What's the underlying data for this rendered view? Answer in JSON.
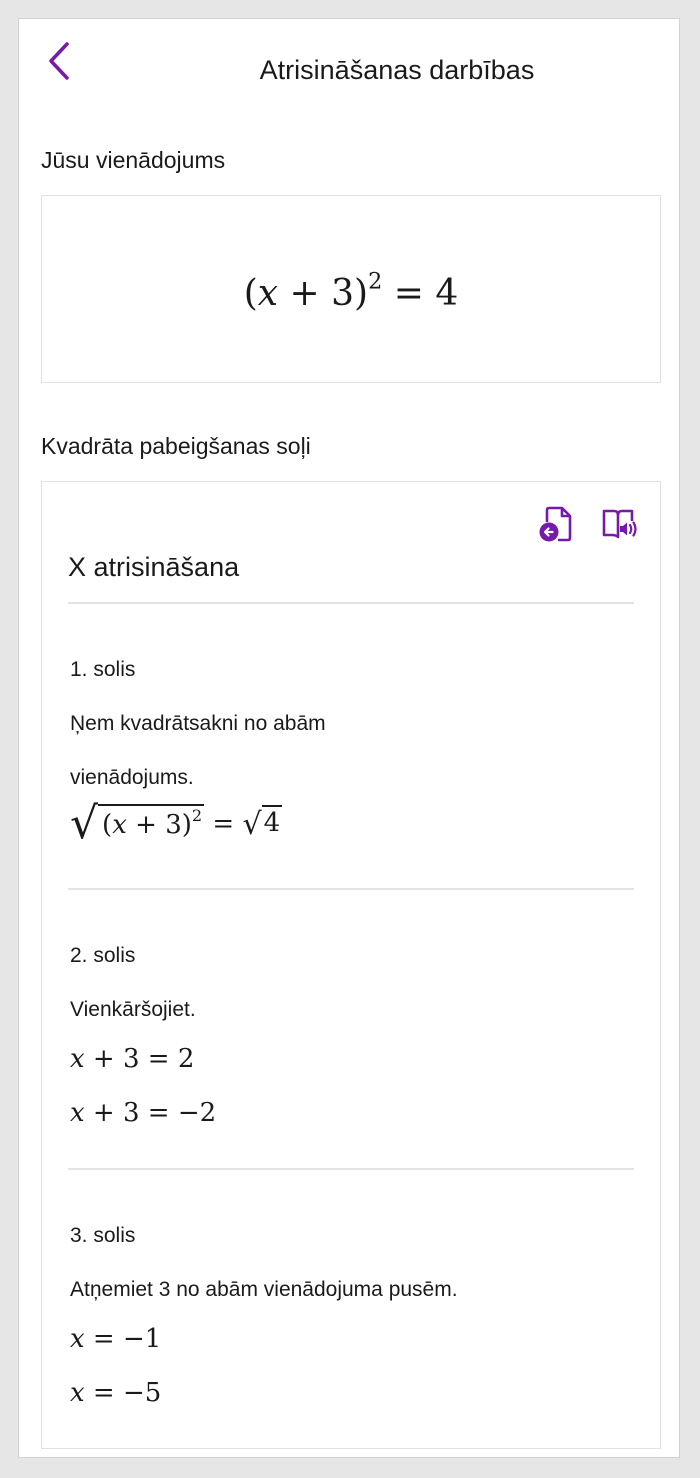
{
  "header": {
    "title": "Atrisināšanas darbības",
    "accent_color": "#7719aa"
  },
  "equation_section": {
    "label": "Jūsu vienādojums",
    "equation": {
      "lhs_open": "(",
      "var": "x",
      "plus": " + 3)",
      "exponent": "2",
      "rhs": " = 4"
    }
  },
  "steps_section": {
    "label": "Kvadrāta pabeigšanas soļi",
    "toolbar": {
      "insert_icon": "insert-document-icon",
      "reader_icon": "immersive-reader-icon"
    },
    "heading": "X atrisināšana",
    "steps": [
      {
        "title": "1. solis",
        "description_line1": "Ņem kvadrātsakni no abām",
        "description_line2": "vienādojums.",
        "math": {
          "open": "(",
          "var": "x",
          "plus": " + 3)",
          "exponent": "2",
          "equals": " = ",
          "rhs_radicand": "4"
        }
      },
      {
        "title": "2. solis",
        "description": "Vienkāršojiet.",
        "math_lines": [
          {
            "var": "x",
            "rest": " + 3 = 2"
          },
          {
            "var": "x",
            "rest": " + 3 = −2"
          }
        ]
      },
      {
        "title": "3. solis",
        "description": "Atņemiet 3 no abām vienādojuma pusēm.",
        "math_lines": [
          {
            "var": "x",
            "rest": " = −1"
          },
          {
            "var": "x",
            "rest": " = −5"
          }
        ]
      }
    ]
  }
}
